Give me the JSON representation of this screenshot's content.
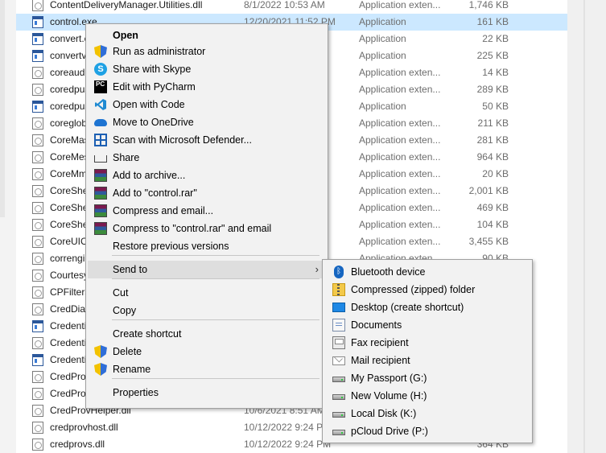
{
  "files": [
    {
      "name": "ContentDeliveryManager.Utilities.dll",
      "date": "8/1/2022 10:53 AM",
      "type": "Application exten...",
      "size": "1,746 KB",
      "icon": "dll-file-icon",
      "selected": false
    },
    {
      "name": "control.exe",
      "date": "12/20/2021 11:52 PM",
      "type": "Application",
      "size": "161 KB",
      "icon": "app-file-icon",
      "selected": true
    },
    {
      "name": "convert.exe",
      "date": "",
      "type": "Application",
      "size": "22 KB",
      "icon": "app-file-icon",
      "selected": false
    },
    {
      "name": "convertvhd.exe",
      "date": "",
      "type": "Application",
      "size": "225 KB",
      "icon": "app-file-icon",
      "selected": false
    },
    {
      "name": "coreaudiopolicy.dll",
      "date": "",
      "type": "Application exten...",
      "size": "14 KB",
      "icon": "dll-file-icon",
      "selected": false
    },
    {
      "name": "coredpus.dll",
      "date": "",
      "type": "Application exten...",
      "size": "289 KB",
      "icon": "dll-file-icon",
      "selected": false
    },
    {
      "name": "coredpussvr.exe",
      "date": "",
      "type": "Application",
      "size": "50 KB",
      "icon": "app-file-icon",
      "selected": false
    },
    {
      "name": "coreglobconfig.dll",
      "date": "",
      "type": "Application exten...",
      "size": "211 KB",
      "icon": "dll-file-icon",
      "selected": false
    },
    {
      "name": "CoreMas.dll",
      "date": "",
      "type": "Application exten...",
      "size": "281 KB",
      "icon": "dll-file-icon",
      "selected": false
    },
    {
      "name": "CoreMessaging.dll",
      "date": "",
      "type": "Application exten...",
      "size": "964 KB",
      "icon": "dll-file-icon",
      "selected": false
    },
    {
      "name": "CoreMmRes.dll",
      "date": "",
      "type": "Application exten...",
      "size": "20 KB",
      "icon": "dll-file-icon",
      "selected": false
    },
    {
      "name": "CoreShell.dll",
      "date": "",
      "type": "Application exten...",
      "size": "2,001 KB",
      "icon": "dll-file-icon",
      "selected": false
    },
    {
      "name": "CoreShellAPI.dll",
      "date": "",
      "type": "Application exten...",
      "size": "469 KB",
      "icon": "dll-file-icon",
      "selected": false
    },
    {
      "name": "CoreShellExtFramework.dll",
      "date": "",
      "type": "Application exten...",
      "size": "104 KB",
      "icon": "dll-file-icon",
      "selected": false
    },
    {
      "name": "CoreUIComponents.dll",
      "date": "",
      "type": "Application exten...",
      "size": "3,455 KB",
      "icon": "dll-file-icon",
      "selected": false
    },
    {
      "name": "correngine.dll",
      "date": "",
      "type": "Application exten...",
      "size": "90 KB",
      "icon": "dll-file-icon",
      "selected": false
    },
    {
      "name": "CourtesyEngine.dll",
      "date": "",
      "type": "",
      "size": "",
      "icon": "dll-file-icon",
      "selected": false
    },
    {
      "name": "CPFilters.dll",
      "date": "",
      "type": "",
      "size": "",
      "icon": "dll-file-icon",
      "selected": false
    },
    {
      "name": "CredDialogBroker.dll",
      "date": "",
      "type": "",
      "size": "",
      "icon": "dll-file-icon",
      "selected": false
    },
    {
      "name": "CredentialEnrollmentManager.exe",
      "date": "",
      "type": "",
      "size": "",
      "icon": "app-file-icon",
      "selected": false
    },
    {
      "name": "CredentialUIBroker.exe",
      "date": "",
      "type": "",
      "size": "",
      "icon": "dll-file-icon",
      "selected": false
    },
    {
      "name": "CredentialUIBroker.exe",
      "date": "",
      "type": "",
      "size": "",
      "icon": "app-file-icon",
      "selected": false
    },
    {
      "name": "CredProv2faHelper.dll",
      "date": "",
      "type": "",
      "size": "",
      "icon": "dll-file-icon",
      "selected": false
    },
    {
      "name": "CredProvDataModel.dll",
      "date": "",
      "type": "",
      "size": "",
      "icon": "dll-file-icon",
      "selected": false
    },
    {
      "name": "CredProvHelper.dll",
      "date": "10/6/2021 8:51 AM",
      "type": "",
      "size": "",
      "icon": "dll-file-icon",
      "selected": false
    },
    {
      "name": "credprovhost.dll",
      "date": "10/12/2022 9:24 PM",
      "type": "",
      "size": "",
      "icon": "dll-file-icon",
      "selected": false
    },
    {
      "name": "credprovs.dll",
      "date": "10/12/2022 9:24 PM",
      "type": "",
      "size": "364 KB",
      "icon": "dll-file-icon",
      "selected": false
    }
  ],
  "context_menu": {
    "items": [
      {
        "label": "Open",
        "icon": "",
        "bold": true
      },
      {
        "label": "Run as administrator",
        "icon": "uac-shield-icon"
      },
      {
        "label": "Share with Skype",
        "icon": "skype-icon"
      },
      {
        "label": "Edit with PyCharm",
        "icon": "pycharm-icon"
      },
      {
        "label": "Open with Code",
        "icon": "vscode-icon"
      },
      {
        "label": "Move to OneDrive",
        "icon": "onedrive-cloud-icon"
      },
      {
        "label": "Scan with Microsoft Defender...",
        "icon": "defender-icon"
      },
      {
        "label": "Share",
        "icon": "share-icon"
      },
      {
        "label": "Add to archive...",
        "icon": "winrar-icon"
      },
      {
        "label": "Add to \"control.rar\"",
        "icon": "winrar-icon"
      },
      {
        "label": "Compress and email...",
        "icon": "winrar-icon"
      },
      {
        "label": "Compress to \"control.rar\" and email",
        "icon": "winrar-icon"
      },
      {
        "label": "Restore previous versions",
        "icon": ""
      },
      {
        "label": "Send to",
        "icon": "",
        "submenu": true
      },
      {
        "label": "Cut",
        "icon": ""
      },
      {
        "label": "Copy",
        "icon": ""
      },
      {
        "label": "Create shortcut",
        "icon": ""
      },
      {
        "label": "Delete",
        "icon": "uac-shield-icon"
      },
      {
        "label": "Rename",
        "icon": "uac-shield-icon"
      },
      {
        "label": "Properties",
        "icon": ""
      }
    ]
  },
  "send_to": {
    "items": [
      {
        "label": "Bluetooth device",
        "icon": "bluetooth-icon"
      },
      {
        "label": "Compressed (zipped) folder",
        "icon": "zip-folder-icon"
      },
      {
        "label": "Desktop (create shortcut)",
        "icon": "desktop-icon"
      },
      {
        "label": "Documents",
        "icon": "documents-icon"
      },
      {
        "label": "Fax recipient",
        "icon": "fax-icon"
      },
      {
        "label": "Mail recipient",
        "icon": "mail-icon"
      },
      {
        "label": "My Passport (G:)",
        "icon": "drive-icon"
      },
      {
        "label": "New Volume (H:)",
        "icon": "drive-icon"
      },
      {
        "label": "Local Disk (K:)",
        "icon": "drive-icon"
      },
      {
        "label": "pCloud Drive (P:)",
        "icon": "drive-icon"
      }
    ]
  },
  "colors": {
    "selection": "#cce8ff",
    "menu_bg": "#f2f2f2",
    "hover": "#dedede"
  }
}
